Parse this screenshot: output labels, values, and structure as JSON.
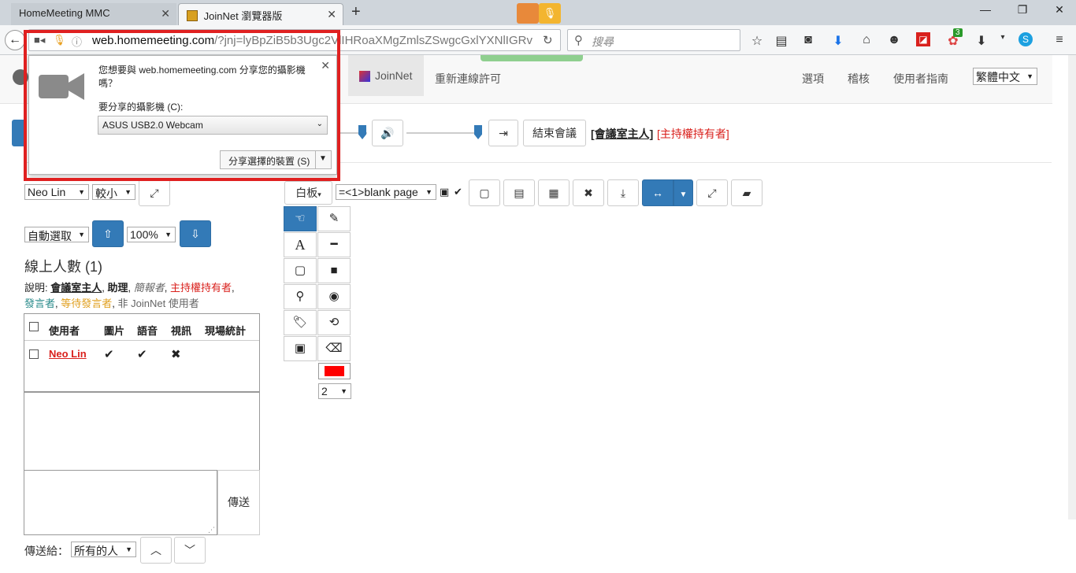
{
  "browser": {
    "tabs": [
      {
        "title": "HomeMeeting MMC",
        "active": false
      },
      {
        "title": "JoinNet 瀏覽器版",
        "active": true
      }
    ],
    "new_tab_label": "+",
    "url_host": "web.homemeeting.com",
    "url_rest": "/?jnj=lyBpZiB5b3Ugc2VlIHRoaXMgZmlsZSwgcGxlYXNlIGRv",
    "search_placeholder": "搜尋",
    "badge_count": "3"
  },
  "app_header": {
    "joinnet_label": "JoinNet",
    "reconnect_label": "重新連線許可",
    "options_label": "選項",
    "audit_label": "稽核",
    "guide_label": "使用者指南",
    "language": "繁體中文"
  },
  "toolbar": {
    "end_meeting_label": "結束會議",
    "owner_label": "[會議室主人]",
    "host_label": "[主持權持有者]"
  },
  "left_panel": {
    "user_select": "Neo Lin",
    "size_select": "較小",
    "auto_select": "自動選取",
    "zoom_select": "100%",
    "online_count_label": "線上人數 (1)",
    "legend_prefix": "說明: ",
    "legend_owner": "會議室主人",
    "legend_assistant": "助理",
    "legend_presenter": "簡報者",
    "legend_host": "主持權持有者",
    "legend_speaker": "發言者",
    "legend_waiting": "等待發言者",
    "legend_non": "非 JoinNet 使用者",
    "table_headers": [
      "使用者",
      "圖片",
      "語音",
      "視訊",
      "現場統計"
    ],
    "row_user": "Neo Lin",
    "row_picture": "✔",
    "row_audio": "✔",
    "row_video": "✖",
    "send_label": "傳送",
    "send_to_label": "傳送給：",
    "send_to_select": "所有的人"
  },
  "whiteboard": {
    "mode_label": "白板",
    "page_select": "=<1>blank page",
    "pen_width": "2",
    "pen_color": "#ff0000"
  },
  "popup": {
    "question": "您想要與 web.homemeeting.com 分享您的攝影機嗎？",
    "camera_label": "要分享的攝影機 (C):",
    "camera_select": "ASUS USB2.0 Webcam",
    "share_button": "分享選擇的裝置 (S)"
  },
  "colors": {
    "accent": "#337ab7",
    "red": "#e02020",
    "host_red": "#d9211d",
    "speaker_teal": "#2a8b8b",
    "waiting_gold": "#e0a020"
  }
}
